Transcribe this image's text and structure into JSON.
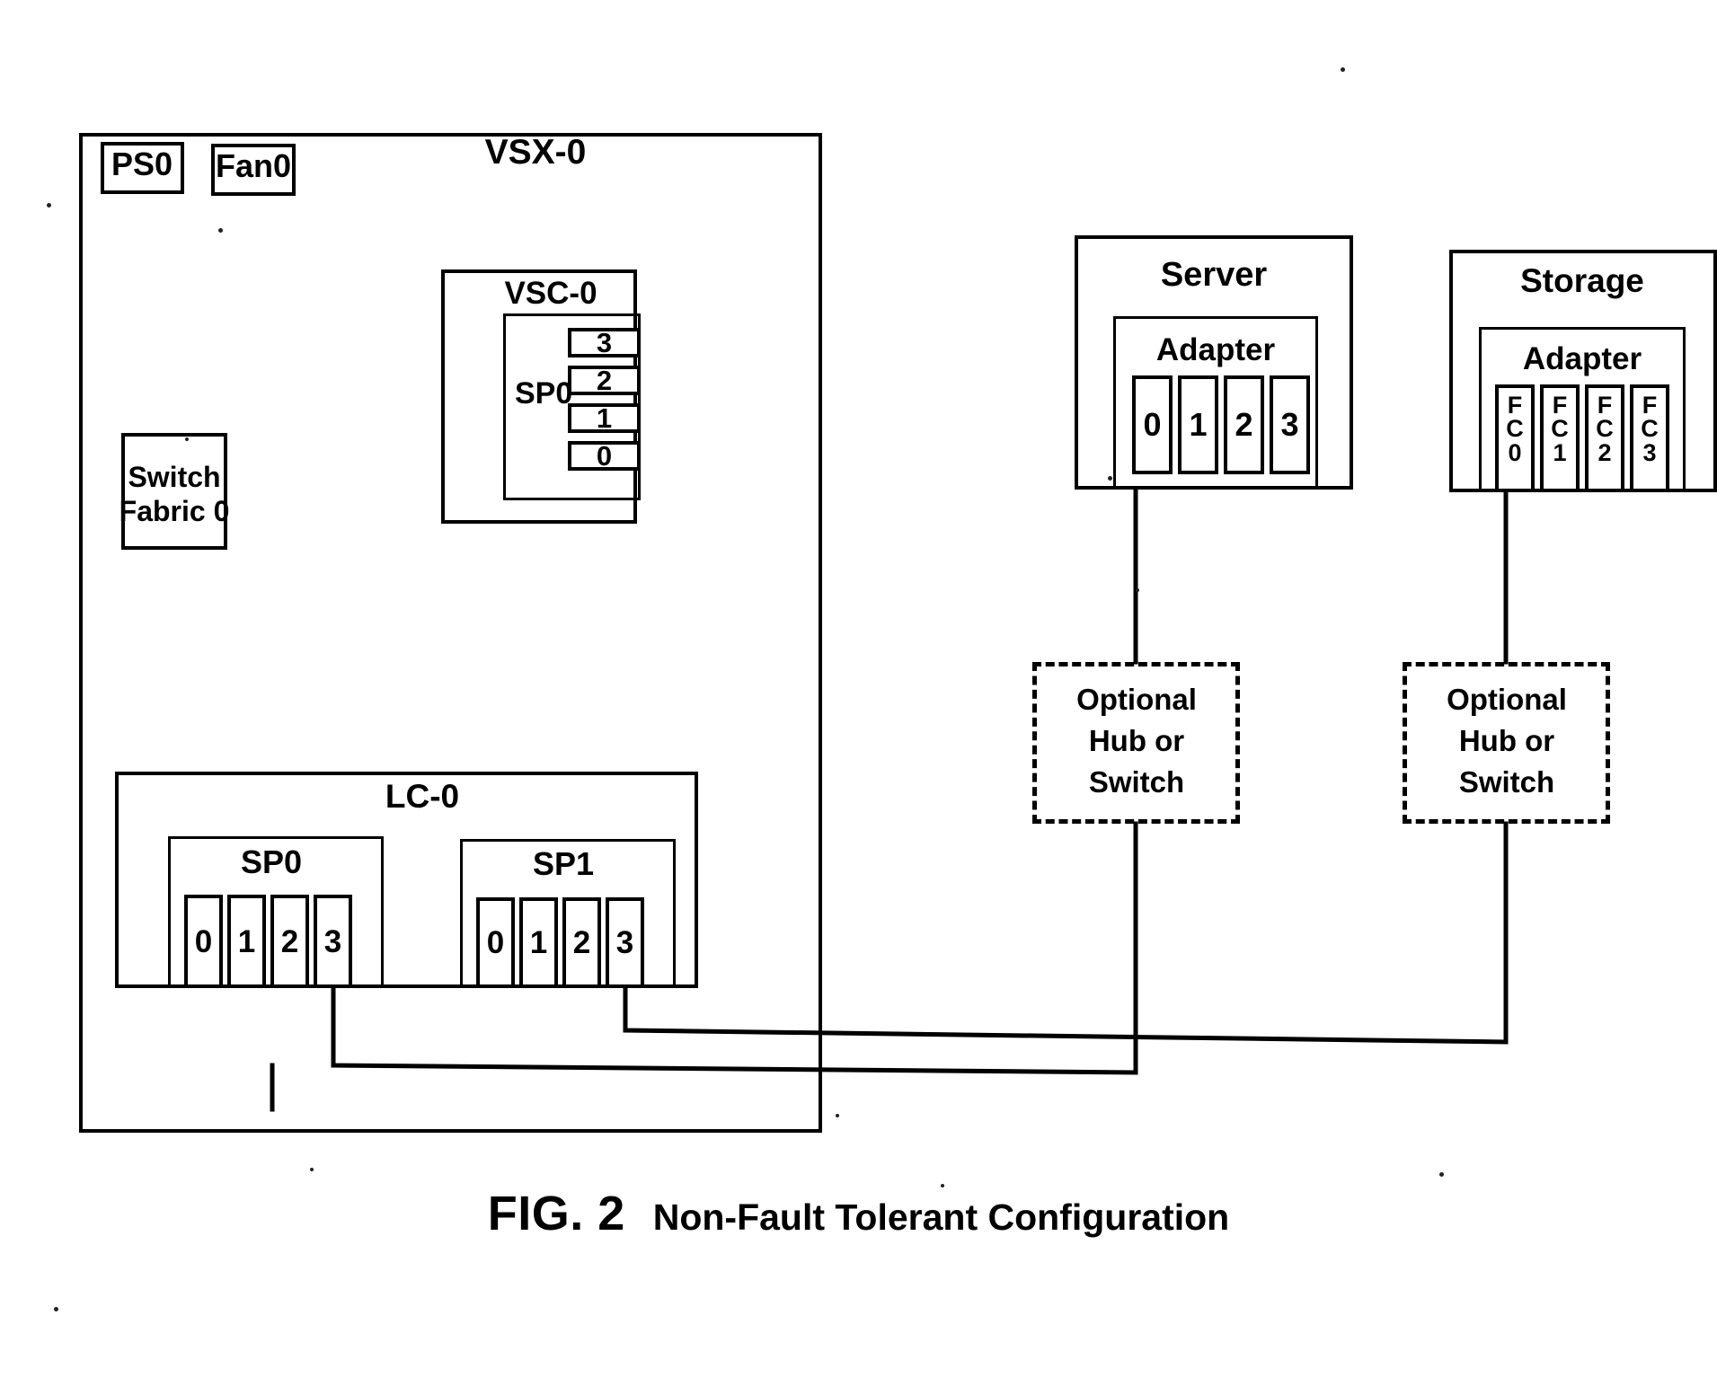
{
  "figure": {
    "number": "FIG. 2",
    "title": "Non-Fault Tolerant Configuration"
  },
  "chassis": {
    "label": "VSX-0",
    "power_supply": {
      "label": "PS0"
    },
    "fan": {
      "label": "Fan0"
    },
    "switch_fabric": {
      "line1": "Switch",
      "line2": "Fabric 0"
    },
    "vsc": {
      "label": "VSC-0",
      "sp": {
        "label": "SP0",
        "ports": [
          "3",
          "2",
          "1",
          "0"
        ]
      }
    },
    "lc": {
      "label": "LC-0",
      "storage_processors": [
        {
          "label": "SP0",
          "ports": [
            "0",
            "1",
            "2",
            "3"
          ]
        },
        {
          "label": "SP1",
          "ports": [
            "0",
            "1",
            "2",
            "3"
          ]
        }
      ]
    }
  },
  "server": {
    "label": "Server",
    "adapter": {
      "label": "Adapter",
      "ports": [
        "0",
        "1",
        "2",
        "3"
      ]
    }
  },
  "storage": {
    "label": "Storage",
    "adapter": {
      "label": "Adapter",
      "ports": [
        {
          "lines": [
            "F",
            "C",
            "0"
          ]
        },
        {
          "lines": [
            "F",
            "C",
            "1"
          ]
        },
        {
          "lines": [
            "F",
            "C",
            "2"
          ]
        },
        {
          "lines": [
            "F",
            "C",
            "3"
          ]
        }
      ]
    }
  },
  "optional_devices": [
    {
      "line1": "Optional",
      "line2": "Hub or",
      "line3": "Switch"
    },
    {
      "line1": "Optional",
      "line2": "Hub or",
      "line3": "Switch"
    }
  ],
  "colors": {
    "ink": "#000000",
    "paper": "#ffffff"
  }
}
